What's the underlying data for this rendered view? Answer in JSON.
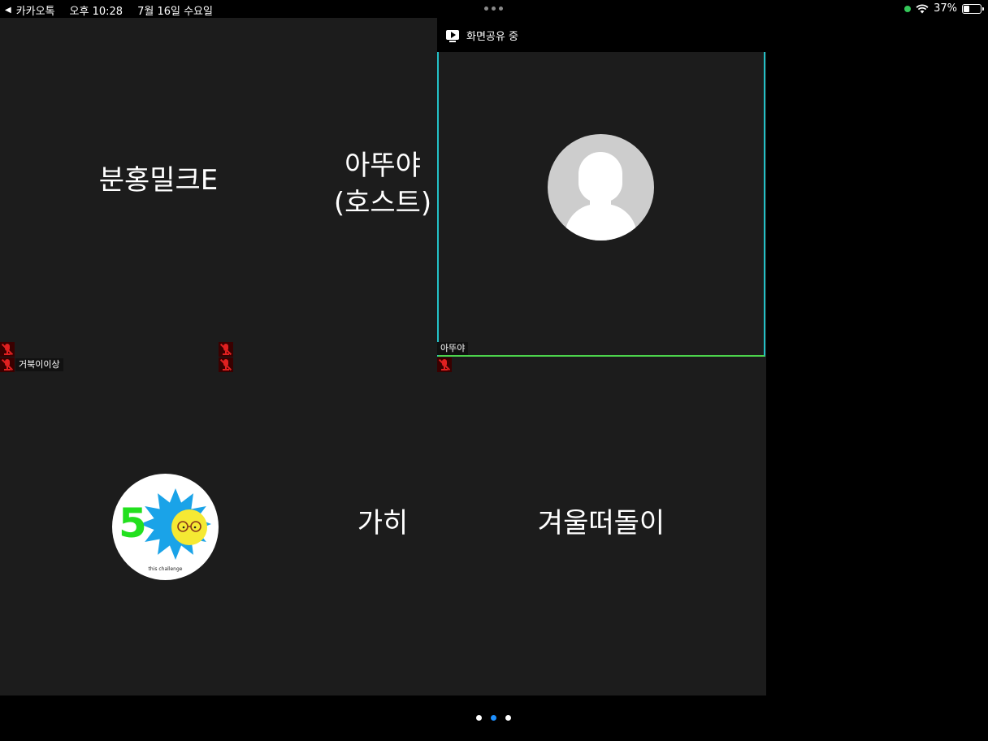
{
  "status_bar": {
    "back_app": "카카오톡",
    "time": "오후 10:28",
    "date": "7월 16일 수요일",
    "battery": "37%",
    "battery_level": 0.37
  },
  "share_banner": {
    "label": "화면공유 중"
  },
  "participants": [
    {
      "display_name": "분홍밀크E",
      "name_tag": "거북이이상",
      "muted": true
    },
    {
      "display_name_line1": "아뚜야",
      "display_name_line2": "(호스트)",
      "muted": true
    },
    {
      "name_tag": "아뚜야",
      "avatar": "default-person-avatar",
      "active_speaker": true,
      "muted": true
    },
    {
      "avatar": "50-challenge-logo",
      "logo_number": "5",
      "logo_caption": "this challenge"
    },
    {
      "display_name": "가히"
    },
    {
      "display_name": "겨울떠돌이"
    }
  ],
  "pagination": {
    "pages": 3,
    "current": 2
  },
  "colors": {
    "tile_bg": "#1c1c1c",
    "active_border_top": "#23c0c7",
    "active_border_bottom": "#4cd34c",
    "mute_red": "#e02020",
    "page_dot_active": "#1e90ff"
  }
}
